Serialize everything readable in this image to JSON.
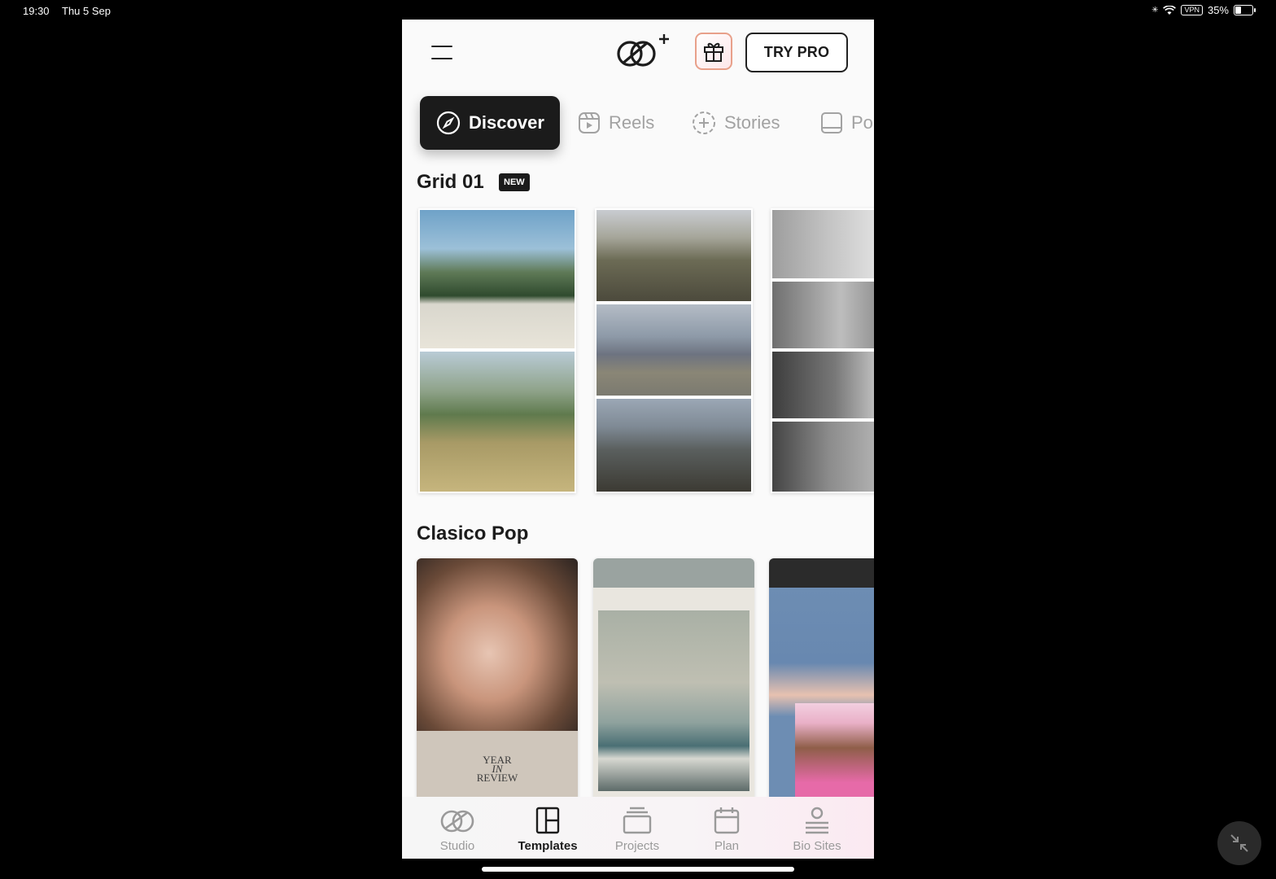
{
  "status_bar": {
    "time": "19:30",
    "date": "Thu 5 Sep",
    "vpn": "VPN",
    "battery": "35%"
  },
  "header": {
    "menu_icon": "hamburger-icon",
    "logo_icon": "unfold-logo-plus-icon",
    "gift_icon": "gift-icon",
    "try_pro_label": "TRY PRO"
  },
  "tabs": [
    {
      "label": "Discover",
      "icon": "compass-icon",
      "active": true
    },
    {
      "label": "Reels",
      "icon": "reels-icon",
      "active": false
    },
    {
      "label": "Stories",
      "icon": "stories-icon",
      "active": false
    },
    {
      "label": "Po",
      "icon": "post-icon",
      "active": false
    }
  ],
  "sections": [
    {
      "title": "Grid 01",
      "badge": "NEW"
    },
    {
      "title": "Clasico Pop",
      "badge": ""
    }
  ],
  "template_text": {
    "year_in_review_1": "YEAR",
    "year_in_review_2": "IN",
    "year_in_review_3": "REVIEW"
  },
  "bottom_nav": [
    {
      "label": "Studio",
      "icon": "studio-icon",
      "active": false
    },
    {
      "label": "Templates",
      "icon": "templates-icon",
      "active": true
    },
    {
      "label": "Projects",
      "icon": "projects-icon",
      "active": false
    },
    {
      "label": "Plan",
      "icon": "calendar-icon",
      "active": false
    },
    {
      "label": "Bio Sites",
      "icon": "bio-sites-icon",
      "active": false
    }
  ],
  "colors": {
    "accent_dark": "#1b1b1b",
    "inactive_gray": "#a2a2a2",
    "gift_border": "#e8a08a"
  }
}
